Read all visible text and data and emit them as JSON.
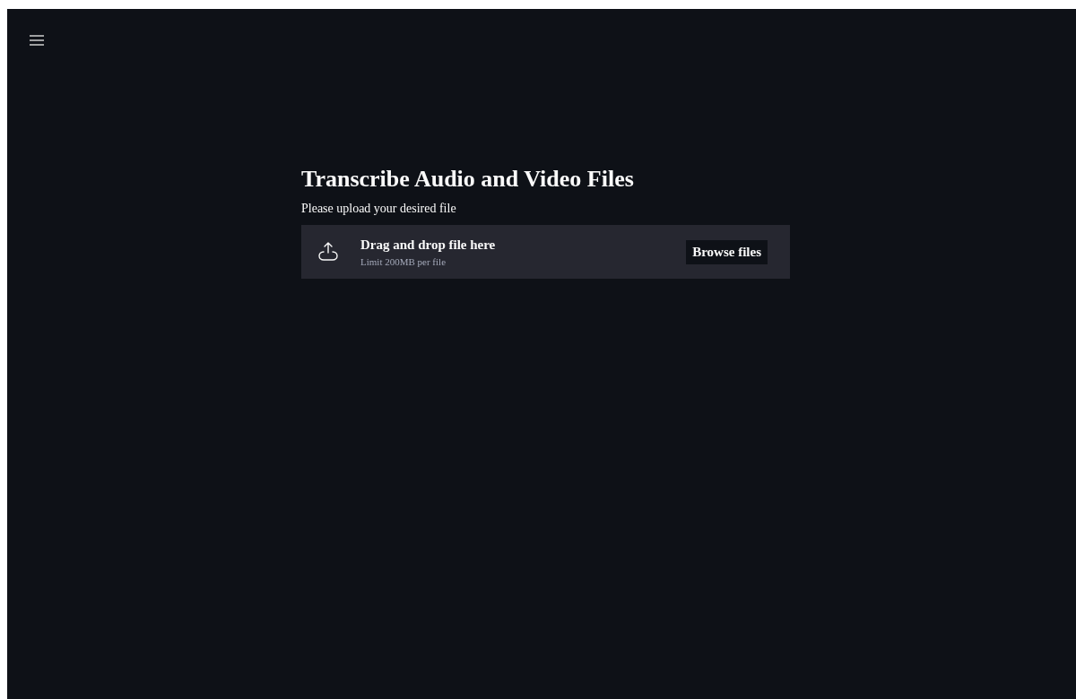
{
  "title": "Transcribe Audio and Video Files",
  "prompt": "Please upload your desired file",
  "dropzone": {
    "heading": "Drag and drop file here",
    "limit": "Limit 200MB per file",
    "button": "Browse files"
  }
}
